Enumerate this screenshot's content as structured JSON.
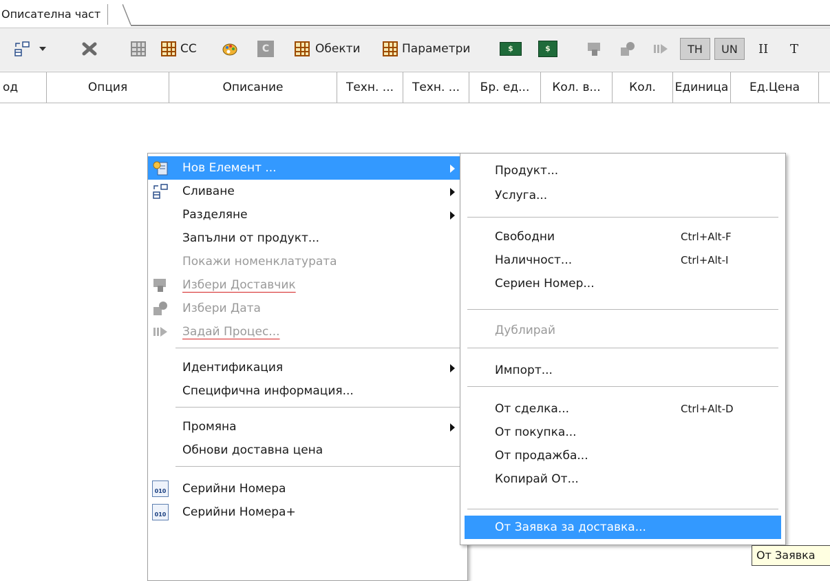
{
  "tab": {
    "title": "Описателна част"
  },
  "toolbar": {
    "cc_label": "CC",
    "objects_label": "Обекти",
    "params_label": "Параметри",
    "money1": "$",
    "money2": "$",
    "th_label": "TH",
    "un_label": "UN",
    "ii_label": "II",
    "t_label": "T",
    "c_label": "C"
  },
  "columns": [
    "од",
    "Опция",
    "Описание",
    "Техн. ...",
    "Техн. ...",
    "Бр. ед...",
    "Кол. в...",
    "Кол.",
    "Единица",
    "Ед.Цена"
  ],
  "context_menu": {
    "items": [
      {
        "label": "Нов Елемент ...",
        "icon": "new-element-icon",
        "submenu": true,
        "selected": true
      },
      {
        "label": "Сливане",
        "icon": "merge-icon",
        "submenu": true
      },
      {
        "label": "Разделяне",
        "submenu": true
      },
      {
        "label": "Запълни от продукт..."
      },
      {
        "label": "Покажи номенклатурата",
        "disabled": true
      },
      {
        "label": "Избери Доставчик",
        "icon": "supplier-icon",
        "disabled": true
      },
      {
        "label": "Избери Дата",
        "icon": "date-icon",
        "disabled": true
      },
      {
        "label": "Задай Процес...",
        "icon": "process-icon",
        "disabled": true
      },
      {
        "label": "Идентификация",
        "submenu": true
      },
      {
        "label": "Специфична информация..."
      },
      {
        "label": "Промяна",
        "submenu": true
      },
      {
        "label": "Обнови доставна цена"
      },
      {
        "label": "Серийни Номера",
        "icon": "serial-numbers-icon"
      },
      {
        "label": "Серийни Номера+",
        "icon": "serial-numbers-plus-icon"
      }
    ]
  },
  "submenu": {
    "items": [
      {
        "label": "Продукт..."
      },
      {
        "label": "Услуга..."
      },
      {
        "label": "Свободни",
        "shortcut": "Ctrl+Alt-F"
      },
      {
        "label": "Наличност...",
        "shortcut": "Ctrl+Alt-I"
      },
      {
        "label": "Сериен Номер..."
      },
      {
        "label": "Дублирай",
        "disabled": true
      },
      {
        "label": "Импорт..."
      },
      {
        "label": "От сделка...",
        "shortcut": "Ctrl+Alt-D"
      },
      {
        "label": "От покупка..."
      },
      {
        "label": "От продажба..."
      },
      {
        "label": "Копирай От..."
      },
      {
        "label": "От Заявка за доставка...",
        "selected": true
      }
    ]
  },
  "tooltip": {
    "text": "От Заявка"
  },
  "colors": {
    "selection": "#3399ff",
    "disabled_text": "#9a9a9a",
    "underline_red": "#d42020"
  }
}
